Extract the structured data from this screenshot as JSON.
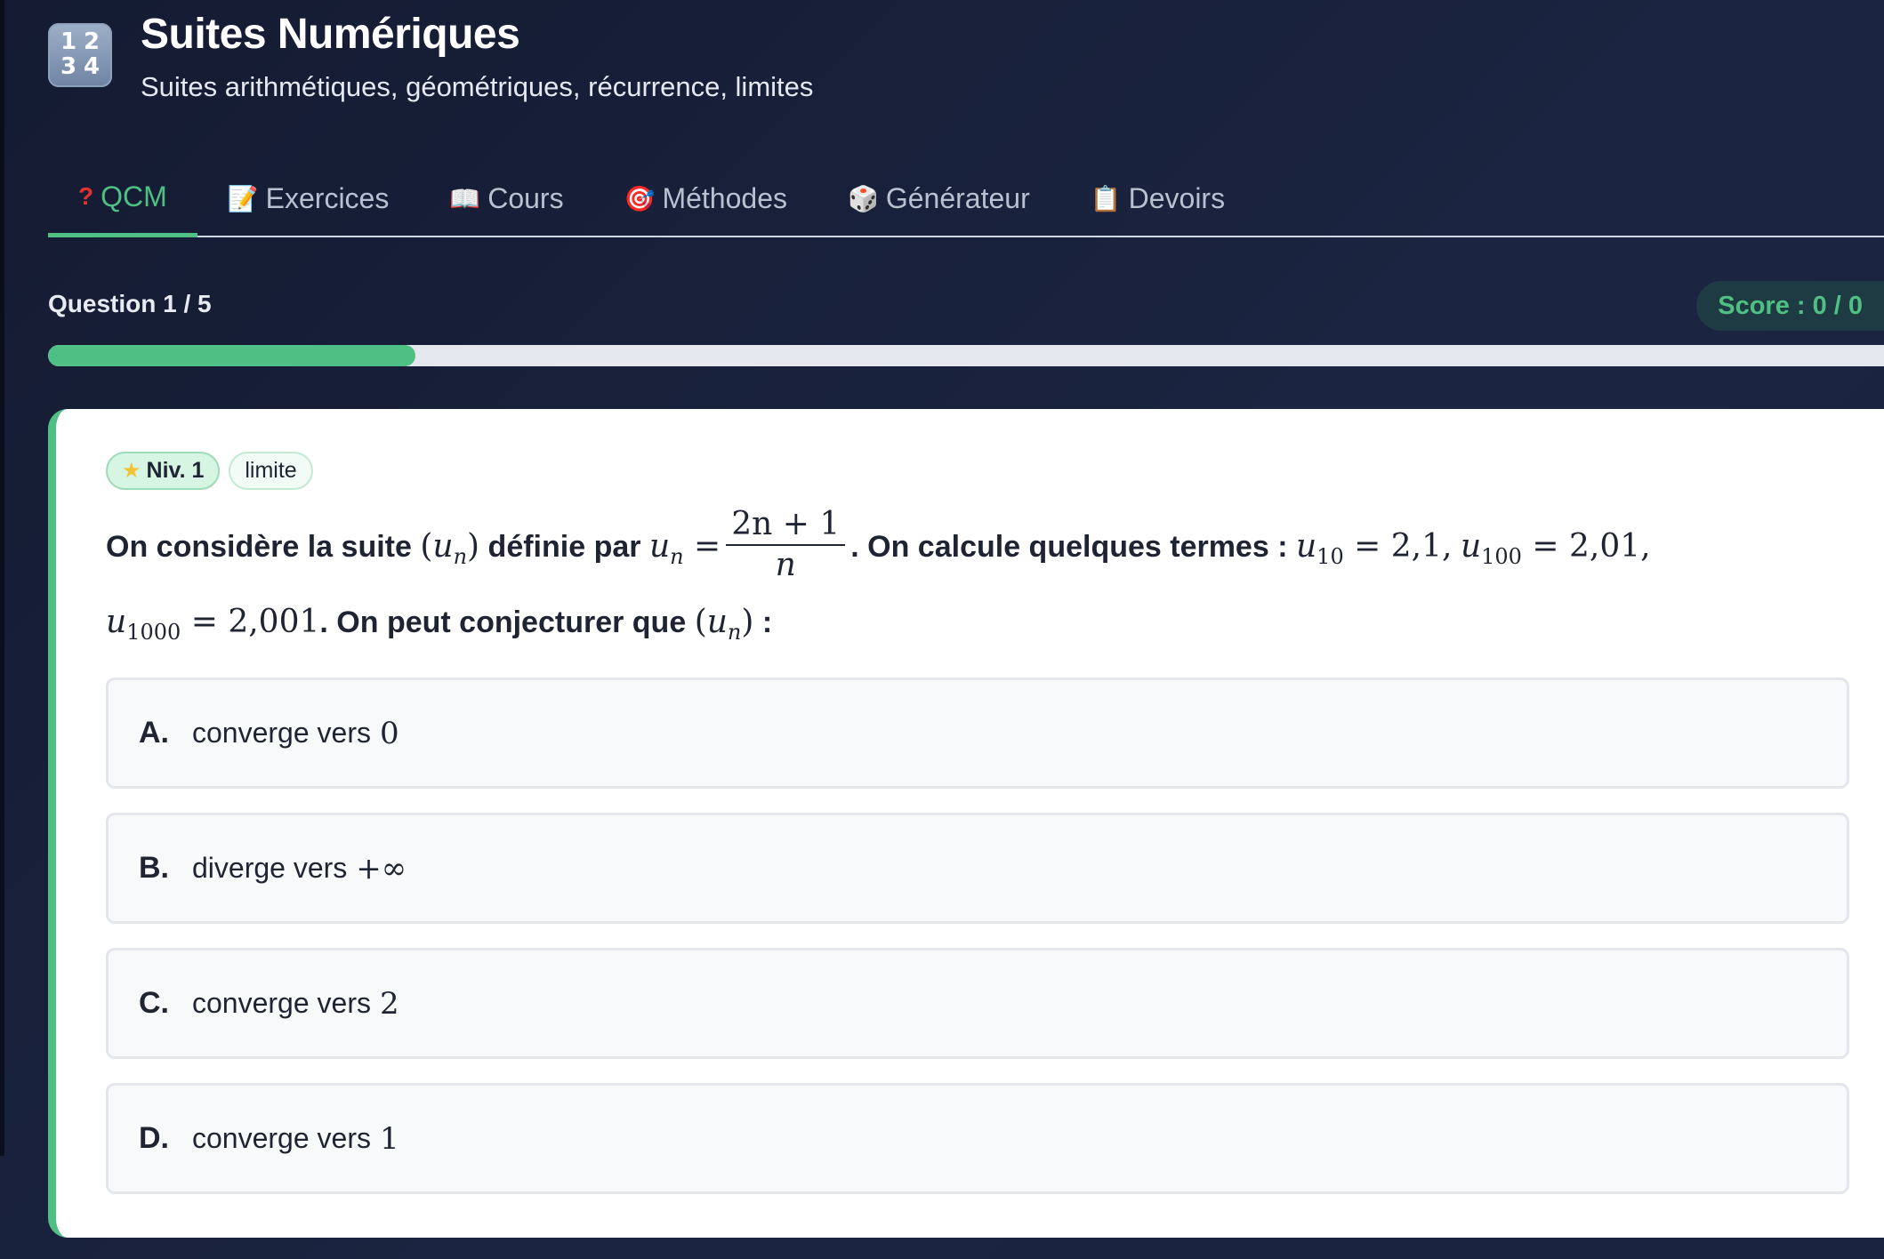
{
  "app": {
    "icon_digits": [
      "1",
      "2",
      "3",
      "4"
    ],
    "title": "Suites Numériques",
    "subtitle": "Suites arithmétiques, géométriques, récurrence, limites"
  },
  "tabs": [
    {
      "icon": "question-mark",
      "glyph": "?",
      "label": "QCM",
      "active": true
    },
    {
      "icon": "memo",
      "glyph": "📝",
      "label": "Exercices",
      "active": false
    },
    {
      "icon": "book",
      "glyph": "📖",
      "label": "Cours",
      "active": false
    },
    {
      "icon": "target",
      "glyph": "🎯",
      "label": "Méthodes",
      "active": false
    },
    {
      "icon": "dice",
      "glyph": "🎲",
      "label": "Générateur",
      "active": false
    },
    {
      "icon": "clipboard",
      "glyph": "📋",
      "label": "Devoirs",
      "active": false
    }
  ],
  "quiz": {
    "question_counter": "Question 1 / 5",
    "score_label": "Score :",
    "score_value": "0 / 0",
    "progress_fraction": 0.2,
    "colors": {
      "accent": "#4fbf84",
      "card": "#ffffff",
      "background": "#1b2440"
    }
  },
  "question": {
    "level_badge": "Niv. 1",
    "tag": "limite",
    "text_1": "On considère la suite",
    "text_2": "définie par",
    "text_3": ". On calcule quelques termes :",
    "text_4": ". On peut conjecturer que",
    "text_5": " :",
    "math_seq": "(u_n)",
    "math_un": "u_n =",
    "frac_num": "2n + 1",
    "frac_den": "n",
    "val_10": "2,1",
    "val_100": "2,01",
    "val_1000": "2,001",
    "sub_10": "10",
    "sub_100": "100",
    "sub_1000": "1000"
  },
  "options": [
    {
      "letter": "A.",
      "text": "converge vers",
      "math": "0"
    },
    {
      "letter": "B.",
      "text": "diverge vers",
      "math": "+∞"
    },
    {
      "letter": "C.",
      "text": "converge vers",
      "math": "2"
    },
    {
      "letter": "D.",
      "text": "converge vers",
      "math": "1"
    }
  ]
}
